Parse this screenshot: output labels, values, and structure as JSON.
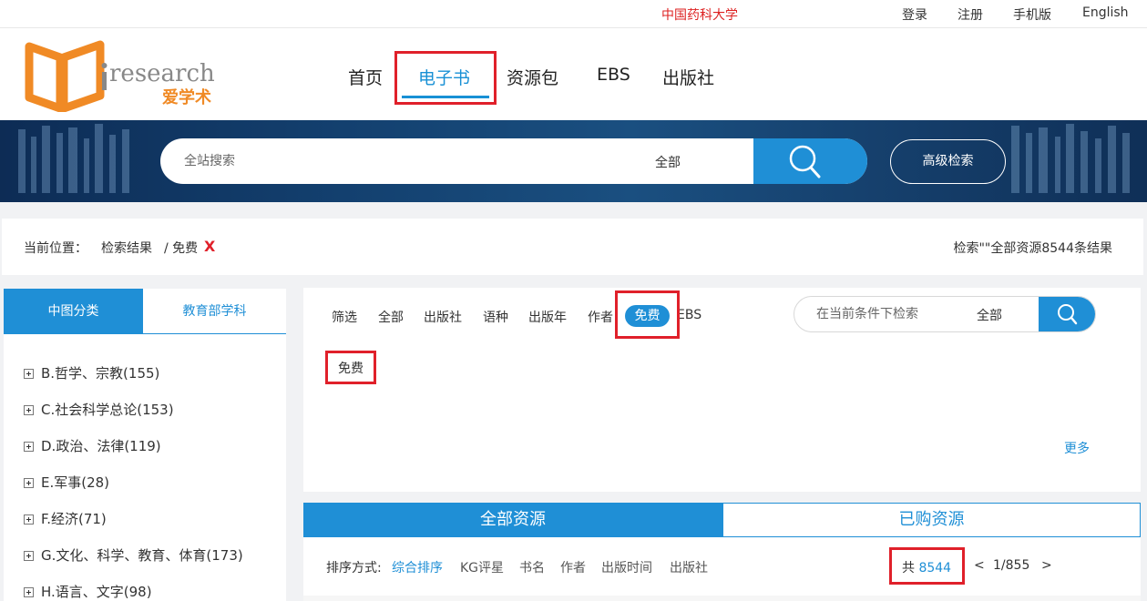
{
  "topbar": {
    "institution": "中国药科大学",
    "login": "登录",
    "register": "注册",
    "mobile": "手机版",
    "english": "English"
  },
  "logo": {
    "text_en": "research",
    "text_cn": "爱学术",
    "icon": "book-logo-icon"
  },
  "nav": {
    "items": [
      "首页",
      "电子书",
      "资源包",
      "EBS",
      "出版社"
    ],
    "active": "电子书"
  },
  "search": {
    "placeholder": "全站搜索",
    "scope": "全部",
    "advanced": "高级检索"
  },
  "breadcrumb": {
    "label": "当前位置：",
    "path": "检索结果",
    "current": "/ 免费",
    "remove": "X",
    "result_text": "检索\"\"全部资源8544条结果"
  },
  "sidebar": {
    "tabs": [
      "中图分类",
      "教育部学科"
    ],
    "active_tab": "中图分类",
    "categories": [
      "B.哲学、宗教(155)",
      "C.社会科学总论(153)",
      "D.政治、法律(119)",
      "E.军事(28)",
      "F.经济(71)",
      "G.文化、科学、教育、体育(173)",
      "H.语言、文字(98)"
    ]
  },
  "filter": {
    "items": [
      "筛选",
      "全部",
      "出版社",
      "语种",
      "出版年",
      "作者"
    ],
    "active": "免费",
    "after": "EBS",
    "chip": "免费",
    "more": "更多",
    "search_placeholder": "在当前条件下检索",
    "search_scope": "全部"
  },
  "result_tabs": [
    "全部资源",
    "已购资源"
  ],
  "sort": {
    "label": "排序方式:",
    "options": [
      "综合排序",
      "KG评星",
      "书名",
      "作者",
      "出版时间",
      "出版社"
    ],
    "active": "综合排序",
    "total_prefix": "共",
    "total": "8544",
    "prev": "<",
    "page": "1/855",
    "next": ">"
  },
  "colors": {
    "accent": "#1f8fd6",
    "highlight_box": "#e0202a",
    "institution": "#dd2222"
  }
}
